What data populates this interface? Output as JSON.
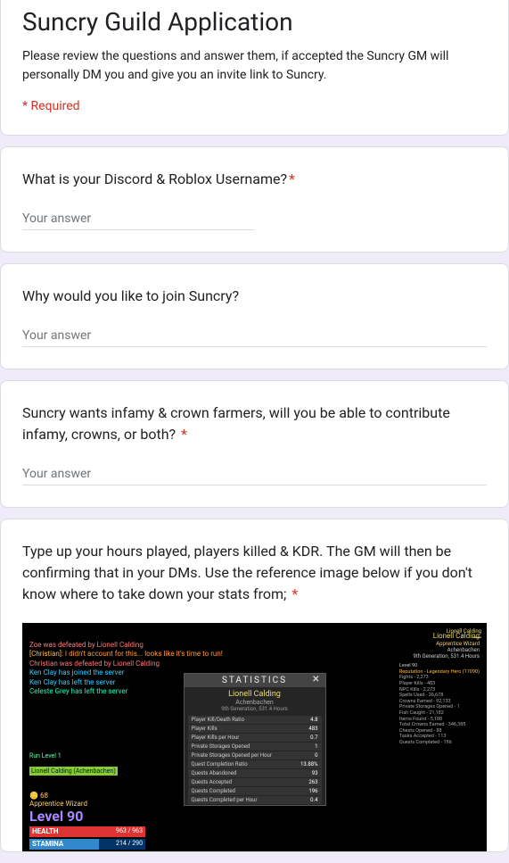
{
  "header": {
    "title": "Suncry Guild Application",
    "description": "Please review the questions and answer them, if accepted the Suncry GM will personally DM you and give you an invite link to Suncry.",
    "required_note": "* Required"
  },
  "q1": {
    "text": "What is your Discord & Roblox Username?",
    "required": true,
    "placeholder": "Your answer"
  },
  "q2": {
    "text": "Why would you like to join Suncry?",
    "required": false,
    "placeholder": "Your answer"
  },
  "q3": {
    "text": "Suncry wants infamy & crown farmers, will you be able to contribute infamy, crowns, or both?",
    "required": true,
    "placeholder": "Your answer"
  },
  "q4": {
    "text": "Type up your hours played, players killed & KDR. The GM will then be confirming that in your DMs. Use the reference image below if you don't know where to take down your stats from;",
    "required": true
  },
  "game": {
    "chat": [
      {
        "color": "#f77",
        "text": "Zoe was defeated by Lionell Calding"
      },
      {
        "color": "#f93",
        "prefix": "[Christian]:",
        "prefixColor": "#fb3",
        "text": " I didn't account for this... looks like it's time to run!"
      },
      {
        "color": "#f77",
        "text": "Christian was defeated by Lionell Calding"
      },
      {
        "color": "#3cf",
        "text": "Ken Clay has joined the server"
      },
      {
        "color": "#3cf",
        "text": "Ken Clay has left the server"
      },
      {
        "color": "#1fb",
        "text": "Celeste Grey has left the server"
      }
    ],
    "runLevel": "Run Level 1",
    "nameBar": "Lionell Calding (Achenbachen)",
    "crowns": "🪙 68",
    "apprentice": "Apprentice Wizard",
    "level": "Level 90",
    "health": {
      "label": "HEALTH",
      "val": "963 / 963"
    },
    "stamina": {
      "label": "STAMINA",
      "val": "214 / 290"
    },
    "panel": {
      "title": "STATISTICS",
      "name": "Lionell Calding",
      "sub": "Achenbachen",
      "sub2": "9th Generation, 531.4 Hours",
      "rows": [
        {
          "k": "Player Kill/Death Ratio",
          "v": "4.8"
        },
        {
          "k": "Player Kills",
          "v": "483"
        },
        {
          "k": "Player Kills per Hour",
          "v": "0.7"
        },
        {
          "k": "Private Storages Opened",
          "v": "1"
        },
        {
          "k": "Private Storages Opened per Hour",
          "v": "0"
        },
        {
          "k": "Quest Completion Ratio",
          "v": "13.88%"
        },
        {
          "k": "Quests Abandoned",
          "v": "93"
        },
        {
          "k": "Quests Accepted",
          "v": "263"
        },
        {
          "k": "Quests Completed",
          "v": "196"
        },
        {
          "k": "Quests Completed per Hour",
          "v": "0.4"
        }
      ]
    },
    "right": {
      "name": "Lionell Calding",
      "sub": "Apprentice Wizard",
      "sub1b": "Achenbachen",
      "sub2": "9th Generation, 531.4 Hours",
      "level": "Level 90",
      "rep": "Reputation - Legendary Hero (17090)",
      "lines": [
        "Fights - 2,273",
        "Player Kills - 483",
        "NPC Kills - 2,273",
        "Spells Used - 26,678",
        "Crowns Earned - 92,133",
        "Private Storages Opened - 1",
        "Fish Caught - 21,182",
        "Items Found - 5,188",
        "Total Crowns Earned - 346,385",
        "Chests Opened - 88",
        "Tasks Accepted - 113",
        "Quests Completed - 196"
      ]
    },
    "corner": "Lionell Calding"
  }
}
